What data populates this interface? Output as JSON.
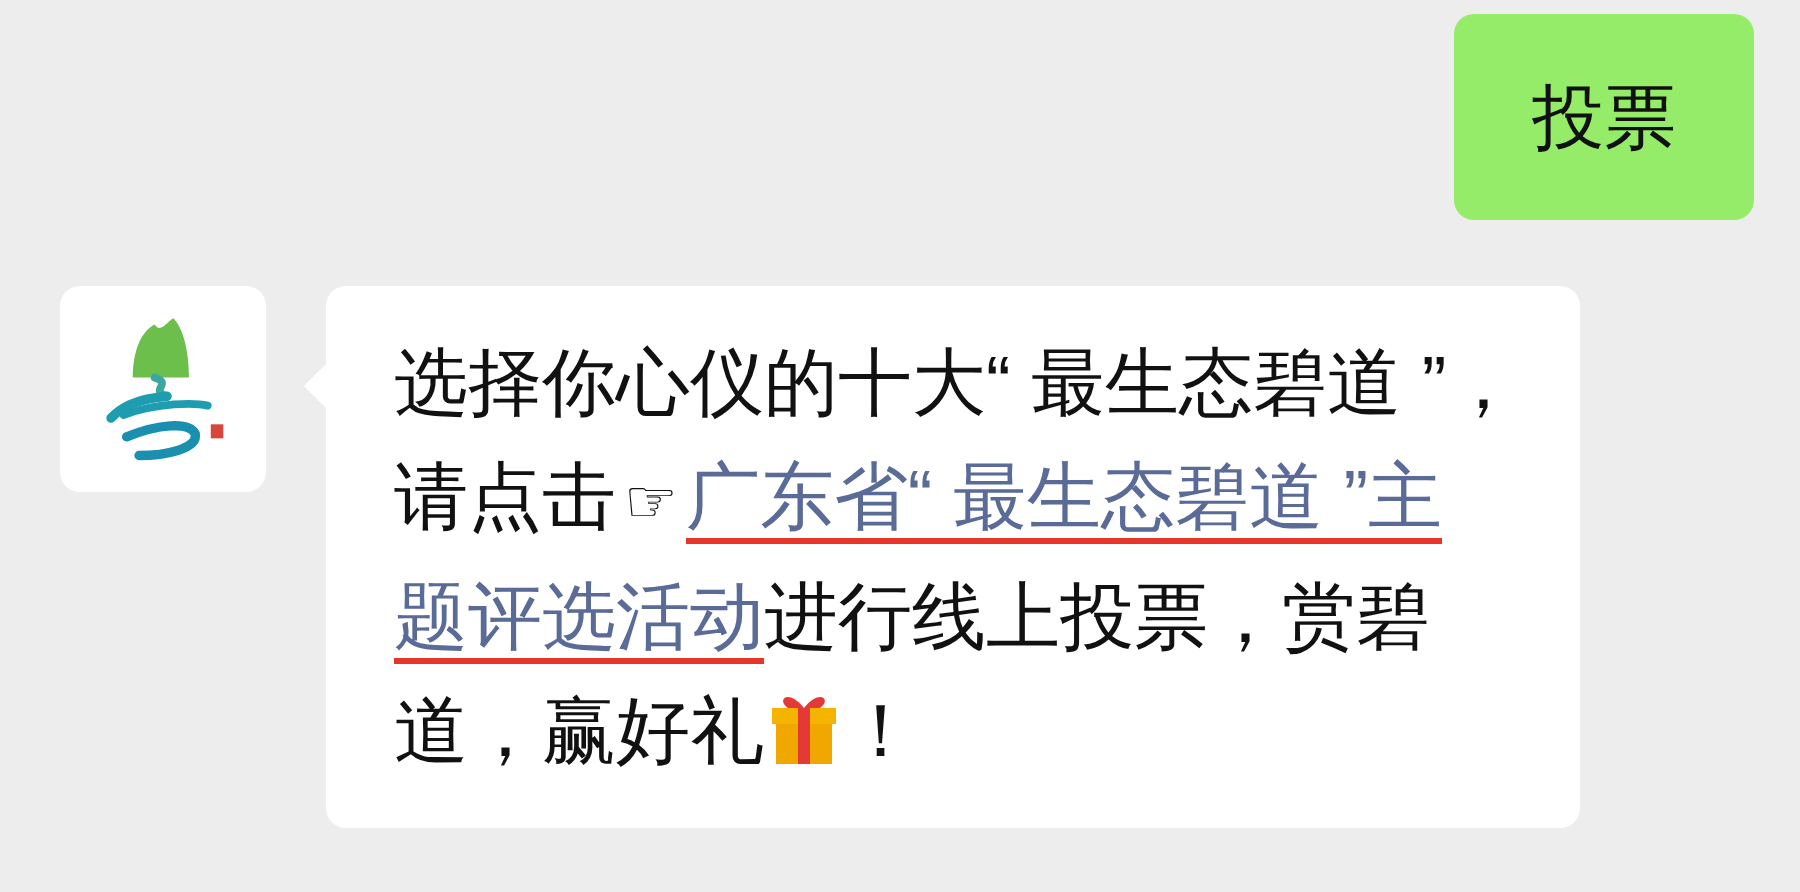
{
  "messages": [
    {
      "kind": "outgoing",
      "lines": [
        [
          {
            "kind": "text",
            "text": "投票"
          }
        ]
      ]
    },
    {
      "kind": "incoming",
      "lines": [
        [
          {
            "kind": "text",
            "text": "选择你心仪的十大“ 最生态碧道 ”，"
          }
        ],
        [
          {
            "kind": "text",
            "text": "请点击"
          },
          {
            "kind": "symbol",
            "text": "☞"
          },
          {
            "kind": "link",
            "text": "广东省“ 最生态碧道 ”主"
          }
        ],
        [
          {
            "kind": "link",
            "text": "题评选活动"
          },
          {
            "kind": "text",
            "text": "进行线上投票，赏碧"
          }
        ],
        [
          {
            "kind": "text",
            "text": "道，赢好礼"
          },
          {
            "kind": "gift"
          },
          {
            "kind": "text",
            "text": "！"
          }
        ]
      ]
    }
  ]
}
